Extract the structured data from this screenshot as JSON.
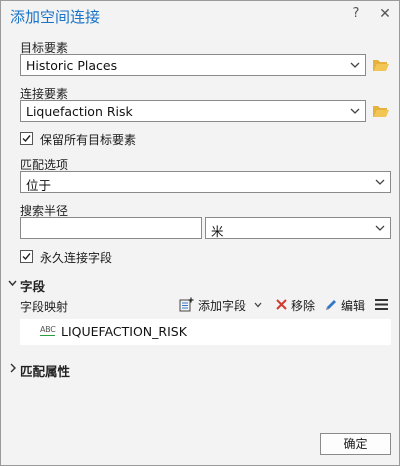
{
  "dialog": {
    "title": "添加空间连接",
    "help_label": "?",
    "close_label": "✕"
  },
  "target_features": {
    "label": "目标要素",
    "value": "Historic Places"
  },
  "join_features": {
    "label": "连接要素",
    "value": "Liquefaction Risk"
  },
  "keep_all": {
    "label": "保留所有目标要素",
    "checked": true
  },
  "match_option": {
    "label": "匹配选项",
    "value": "位于"
  },
  "search_radius": {
    "label": "搜索半径",
    "value": "",
    "unit": "米"
  },
  "permanent_join": {
    "label": "永久连接字段",
    "checked": true
  },
  "fields_section": {
    "label": "字段",
    "expanded": true,
    "field_map_label": "字段映射",
    "add_field_label": "添加字段",
    "remove_label": "移除",
    "edit_label": "编辑",
    "fields": [
      {
        "type_badge": "ABC",
        "name": "LIQUEFACTION_RISK"
      }
    ]
  },
  "match_attributes_section": {
    "label": "匹配属性",
    "expanded": false
  },
  "ok_button": {
    "label": "确定"
  },
  "colors": {
    "title": "#1a73c7",
    "folder": "#d9a21a",
    "remove_x": "#d13b2f",
    "edit_pen": "#3477c9"
  }
}
